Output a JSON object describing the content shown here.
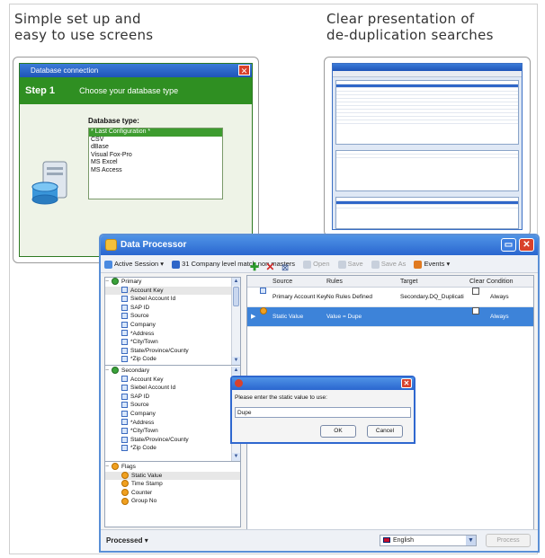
{
  "captions": {
    "left_line1": "Simple set up and",
    "left_line2": "easy to use screens",
    "right_line1": "Clear presentation of",
    "right_line2": "de-duplication searches"
  },
  "wizard": {
    "title": "Database connection",
    "step": "Step 1",
    "heading": "Choose your database type",
    "list_label": "Database type:",
    "options": [
      "* Last Configuration *",
      "CSV",
      "dBase",
      "Visual Fox-Pro",
      "MS Excel",
      "MS Access"
    ],
    "selected_index": 0
  },
  "main": {
    "title": "Data Processor",
    "toolbar": {
      "active_session": "Active Session",
      "session_name": "31 Company level match non masters",
      "open": "Open",
      "save": "Save",
      "save_as": "Save As",
      "events": "Events"
    },
    "tree_primary": {
      "name": "Primary",
      "fields": [
        "Account Key",
        "Siebel Account Id",
        "SAP ID",
        "Source",
        "Company",
        "*Address",
        "*City/Town",
        "State/Province/County",
        "*Zip Code"
      ]
    },
    "tree_secondary": {
      "name": "Secondary",
      "fields": [
        "Account Key",
        "Siebel Account Id",
        "SAP ID",
        "Source",
        "Company",
        "*Address",
        "*City/Town",
        "State/Province/County",
        "*Zip Code"
      ]
    },
    "tree_flags": {
      "name": "Flags",
      "fields": [
        "Static Value",
        "Time Stamp",
        "Counter",
        "Group No"
      ]
    },
    "grid": {
      "columns": [
        "Source",
        "Rules",
        "Target",
        "Clear",
        "Condition"
      ],
      "rows": [
        {
          "source": "Primary Account Key",
          "rules": "No Rules Defined",
          "target": "Secondary.DQ_Duplicati",
          "condition": "Always"
        },
        {
          "source": "Static Value",
          "rules": "Value = Dupe",
          "target": "",
          "condition": "Always"
        }
      ]
    },
    "status": "Processed",
    "language": "English",
    "process_button": "Process"
  },
  "dialog": {
    "prompt": "Please enter the static value to use:",
    "value": "Dupe",
    "ok": "OK",
    "cancel": "Cancel"
  }
}
